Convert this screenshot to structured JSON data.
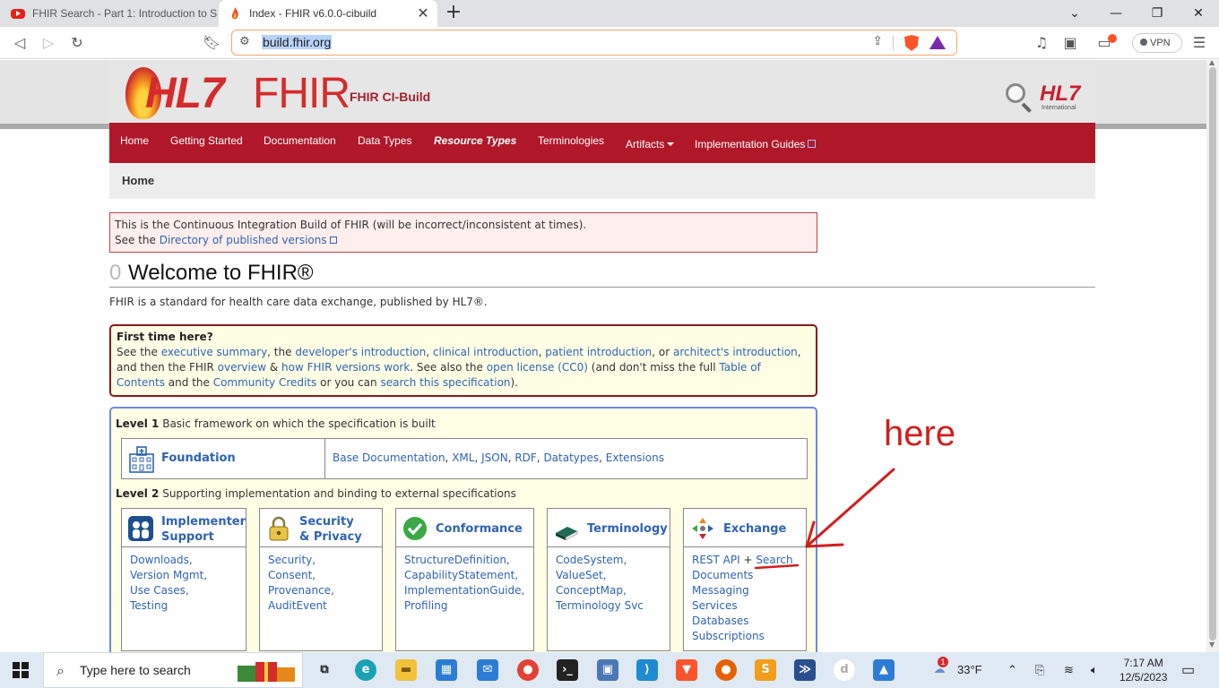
{
  "browser": {
    "tabs": [
      {
        "title": "FHIR Search - Part 1: Introduction to S",
        "active": false
      },
      {
        "title": "Index - FHIR v6.0.0-cibuild",
        "active": true
      }
    ],
    "new_tab": "+",
    "url": "build.fhir.org",
    "vpn_label": "VPN"
  },
  "page": {
    "logo": {
      "hl7": "HL7",
      "fhir": "FHIR",
      "subtitle": "FHIR CI-Build",
      "hl7_mark": "HL7",
      "hl7_intl": "International"
    },
    "nav": {
      "items": [
        "Home",
        "Getting Started",
        "Documentation",
        "Data Types",
        "Resource Types",
        "Terminologies",
        "Artifacts",
        "Implementation Guides"
      ]
    },
    "breadcrumb": "Home",
    "ci_notice": {
      "line1": "This is the Continuous Integration Build of FHIR (will be incorrect/inconsistent at times).",
      "line2_prefix": "See the ",
      "line2_link": "Directory of published versions"
    },
    "heading": {
      "number": "0",
      "title": "Welcome to FHIR®"
    },
    "intro": "FHIR is a standard for health care data exchange, published by HL7®.",
    "first_time": {
      "title": "First time here?",
      "see_the": "See the ",
      "exec": "executive summary",
      "c1": ", the ",
      "dev": "developer's introduction",
      "c2": ", ",
      "clin": "clinical introduction",
      "c3": ", ",
      "pat": "patient introduction",
      "c4": ", or ",
      "arch": "architect's introduction",
      "c5": ",",
      "and_then": "and then the FHIR ",
      "overview": "overview",
      "amp": " & ",
      "versions": "how FHIR versions work",
      "see_also": ". See also the ",
      "license": "open license (CC0)",
      "dont_miss": " (and don't miss the full ",
      "toc": "Table of Contents",
      "and_the": " and the ",
      "credits": "Community Credits",
      "or_you": " or you can ",
      "search": "search this specification",
      "end": ")."
    },
    "levels": {
      "level1_label": "Level 1",
      "level1_text": " Basic framework on which the specification is built",
      "foundation": {
        "title": "Foundation",
        "links": [
          "Base Documentation",
          "XML",
          "JSON",
          "RDF",
          "Datatypes",
          "Extensions"
        ]
      },
      "level2_label": "Level 2",
      "level2_text": " Supporting implementation and binding to external specifications",
      "cards": [
        {
          "title1": "Implementer",
          "title2": "Support",
          "items": [
            "Downloads,",
            "Version Mgmt,",
            "Use Cases,",
            "Testing"
          ]
        },
        {
          "title1": "Security",
          "title2": "& Privacy",
          "items": [
            "Security,",
            "Consent,",
            "Provenance,",
            "AuditEvent"
          ]
        },
        {
          "title1": "Conformance",
          "title2": "",
          "items": [
            "StructureDefinition,",
            "CapabilityStatement,",
            "ImplementationGuide,",
            "Profiling"
          ]
        },
        {
          "title1": "Terminology",
          "title2": "",
          "items": [
            "CodeSystem,",
            "ValueSet,",
            "ConceptMap,",
            "Terminology Svc"
          ]
        },
        {
          "title1": "Exchange",
          "title2": "",
          "items": [
            "REST API",
            "Search",
            "Documents",
            "Messaging",
            "Services",
            "Databases",
            "Subscriptions"
          ]
        }
      ],
      "plus": " + "
    },
    "annotation": "here"
  },
  "taskbar": {
    "search_placeholder": "Type here to search",
    "weather": "33°F",
    "time": "7:17 AM",
    "date": "12/5/2023",
    "weather_badge": "1"
  },
  "colors": {
    "nav_red": "#b0182a",
    "link_blue": "#2f64b0",
    "annotation_red": "#d31d1d"
  }
}
